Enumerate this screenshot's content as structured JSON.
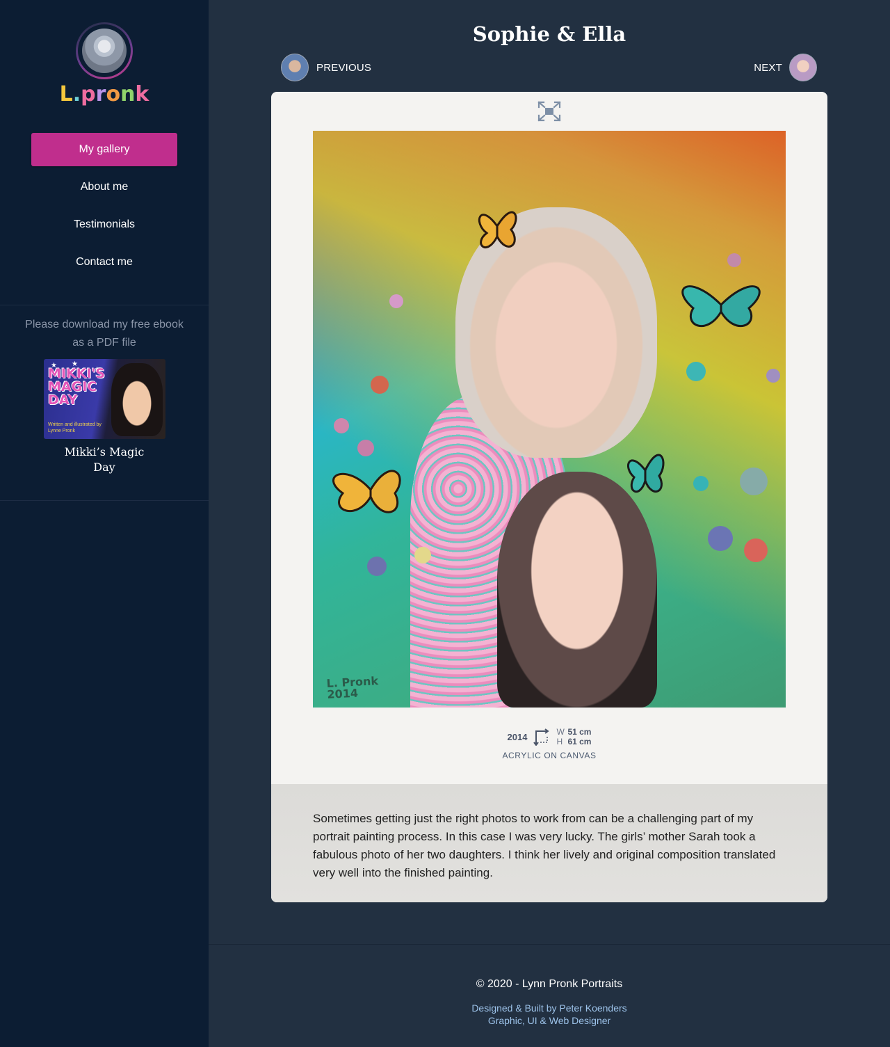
{
  "sidebar": {
    "logo_text": [
      "L",
      ".",
      "p",
      "r",
      "o",
      "n",
      "k"
    ],
    "nav": [
      {
        "label": "My gallery",
        "active": true
      },
      {
        "label": "About me",
        "active": false
      },
      {
        "label": "Testimonials",
        "active": false
      },
      {
        "label": "Contact me",
        "active": false
      }
    ],
    "ebook": {
      "prompt_line1": "Please download my free ebook",
      "prompt_line2": "as a PDF file",
      "cover_title": "MIKKI'S MAGIC DAY",
      "cover_subtitle": "Written and illustrated by Lynne Pronk",
      "title": "Mikki’s Magic Day"
    }
  },
  "artwork": {
    "title": "Sophie & Ella",
    "prev_label": "PREVIOUS",
    "next_label": "NEXT",
    "signature_line1": "L. Pronk",
    "signature_line2": "2014",
    "year": "2014",
    "width_key": "W",
    "width_value": "51 cm",
    "height_key": "H",
    "height_value": "61 cm",
    "medium": "ACRYLIC ON CANVAS",
    "description": "Sometimes getting just the right photos to work from can be a challenging part of my portrait painting process. In this case I was very lucky. The girls’ mother Sarah took a fabulous photo of her two daughters. I think her lively and original composition translated very well into the finished painting."
  },
  "footer": {
    "copyright": "© 2020 - Lynn Pronk Portraits",
    "credit_line1": "Designed & Built by Peter Koenders",
    "credit_line2": "Graphic, UI & Web Designer"
  },
  "colors": {
    "sidebar_bg": "#0c1d33",
    "main_bg": "#223041",
    "accent": "#c02e8d",
    "link": "#9dc3ea"
  }
}
